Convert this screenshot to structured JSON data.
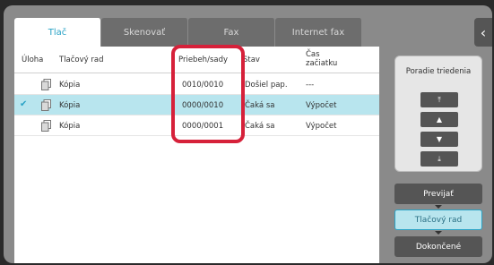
{
  "tabs": [
    "Tlač",
    "Skenovať",
    "Fax",
    "Internet fax"
  ],
  "collapse_icon": "‹",
  "columns": {
    "task": "Úloha",
    "queue": "Tlačový rad",
    "progress": "Priebeh/sady",
    "status": "Stav",
    "start_time_line1": "Čas",
    "start_time_line2": "začiatku"
  },
  "rows": [
    {
      "name": "Kópia",
      "progress": "0010/0010",
      "status": "Došiel pap.",
      "start": "---",
      "selected": false
    },
    {
      "name": "Kópia",
      "progress": "0000/0010",
      "status": "Čaká sa",
      "start": "Výpočet",
      "selected": true
    },
    {
      "name": "Kópia",
      "progress": "0000/0001",
      "status": "Čaká sa",
      "start": "Výpočet",
      "selected": false
    }
  ],
  "sort": {
    "title": "Poradie triedenia",
    "buttons": [
      "⤒",
      "▲",
      "▼",
      "⤓"
    ]
  },
  "side_buttons": {
    "priority": "Previjať",
    "queue": "Tlačový rad",
    "completed": "Dokončené"
  },
  "colors": {
    "accent": "#2aa3c6",
    "highlight": "#d6213a",
    "selected_row": "#b8e5ee"
  }
}
